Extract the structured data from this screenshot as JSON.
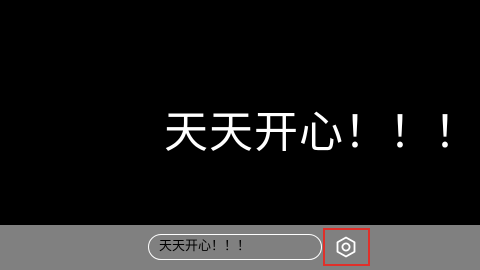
{
  "display": {
    "text": "天天开心！！！",
    "text_color": "#ffffff",
    "background": "#000000"
  },
  "bottom_bar": {
    "background": "#808080",
    "input_value": "天天开心！！！",
    "settings_icon": "settings-hexagon-icon",
    "highlight_color": "#e0302a"
  }
}
